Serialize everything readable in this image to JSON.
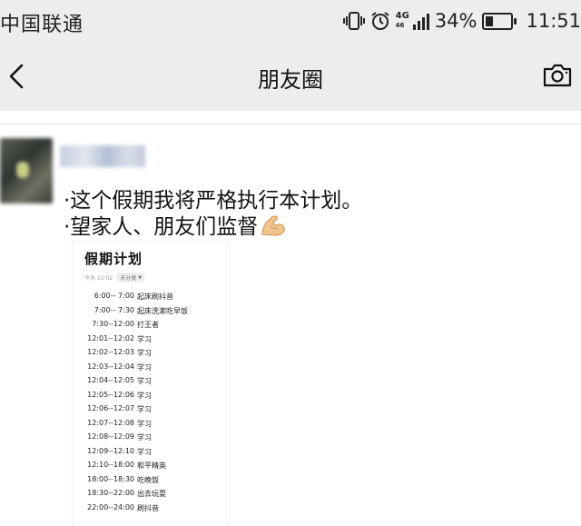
{
  "status_bar": {
    "carrier": "中国联通",
    "network_type": "4G",
    "network_sub": "46",
    "battery_percent": "34%",
    "battery_level": 0.34,
    "time": "11:51",
    "icons": [
      "vibrate-icon",
      "alarm-icon",
      "signal-icon",
      "battery-icon"
    ]
  },
  "nav": {
    "title": "朋友圈",
    "back_icon": "chevron-left-icon",
    "camera_icon": "camera-icon"
  },
  "post": {
    "text_line_1": "·这个假期我将严格执行本计划。",
    "text_line_2": "·望家人、朋友们监督",
    "emoji": "flexed-biceps-icon"
  },
  "plan": {
    "title": "假期计划",
    "meta_date": "今天 12:02",
    "meta_category": "未分类",
    "rows": [
      {
        "time": "6:00-- 7:00",
        "task": "起床刷抖音"
      },
      {
        "time": "7:00-- 7:30",
        "task": "起床洗漱吃早饭"
      },
      {
        "time": "7:30--12:00",
        "task": "打王者"
      },
      {
        "time": "12:01--12:02",
        "task": "学习"
      },
      {
        "time": "12:02--12:03",
        "task": "学习"
      },
      {
        "time": "12:03--12:04",
        "task": "学习"
      },
      {
        "time": "12:04--12:05",
        "task": "学习"
      },
      {
        "time": "12:05--12:06",
        "task": "学习"
      },
      {
        "time": "12:06--12:07",
        "task": "学习"
      },
      {
        "time": "12:07--12:08",
        "task": "学习"
      },
      {
        "time": "12:08--12:09",
        "task": "学习"
      },
      {
        "time": "12:09--12:10",
        "task": "学习"
      },
      {
        "time": "12:10--18:00",
        "task": "和平精英"
      },
      {
        "time": "18:00--18:30",
        "task": "吃晚饭"
      },
      {
        "time": "18:30--22:00",
        "task": "出去玩耍"
      },
      {
        "time": "22:00--24:00",
        "task": "刷抖音"
      }
    ]
  }
}
